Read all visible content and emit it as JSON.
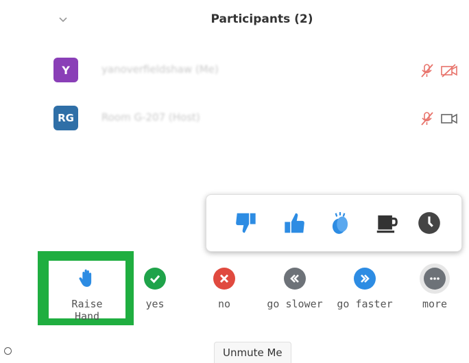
{
  "panel": {
    "title": "Participants (2)"
  },
  "participants": [
    {
      "initials": "Y",
      "avatar_color": "#8a3fb7",
      "name": "yanoverfieldshaw (Me)"
    },
    {
      "initials": "RG",
      "avatar_color": "#2f6fa7",
      "name": "Room G-207 (Host)"
    }
  ],
  "reactions": [
    "thumbs-down-icon",
    "thumbs-up-icon",
    "clap-icon",
    "coffee-icon",
    "clock-icon"
  ],
  "toolbar": {
    "raise_hand": "Raise Hand",
    "yes": "yes",
    "no": "no",
    "go_slower": "go slower",
    "go_faster": "go faster",
    "more": "more"
  },
  "unmute_label": "Unmute Me",
  "colors": {
    "highlight": "#1fae40",
    "blue": "#2d8ce3",
    "green": "#1fa34a",
    "red": "#e04a3f",
    "gray": "#6d7278",
    "muted_red": "#e8736b"
  }
}
